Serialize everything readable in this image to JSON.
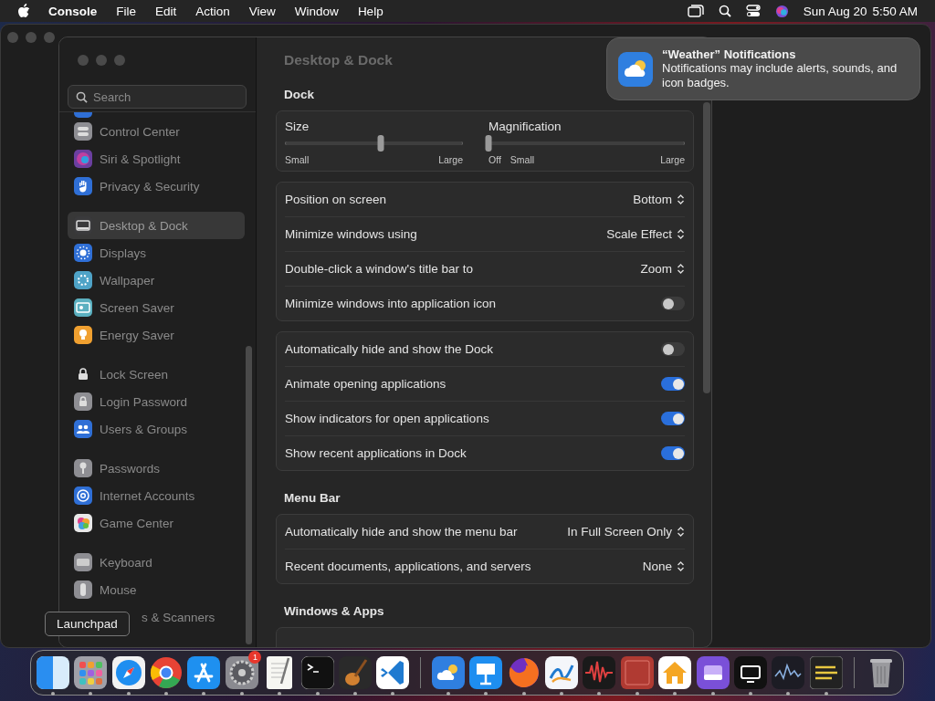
{
  "menu_bar": {
    "app": "Console",
    "menus": [
      "File",
      "Edit",
      "Action",
      "View",
      "Window"
    ],
    "help": "Help",
    "date": "Sun Aug 20",
    "time": "5:50 AM"
  },
  "sidebar": {
    "search": {
      "placeholder": "Search"
    },
    "groups": [
      [
        {
          "label": "Control Center",
          "selected": false
        },
        {
          "label": "Siri & Spotlight",
          "selected": false
        },
        {
          "label": "Privacy & Security",
          "selected": false
        }
      ],
      [
        {
          "label": "Desktop & Dock",
          "selected": true
        },
        {
          "label": "Displays",
          "selected": false
        },
        {
          "label": "Wallpaper",
          "selected": false
        },
        {
          "label": "Screen Saver",
          "selected": false
        },
        {
          "label": "Energy Saver",
          "selected": false
        }
      ],
      [
        {
          "label": "Lock Screen",
          "selected": false
        },
        {
          "label": "Login Password",
          "selected": false
        },
        {
          "label": "Users & Groups",
          "selected": false
        }
      ],
      [
        {
          "label": "Passwords",
          "selected": false
        },
        {
          "label": "Internet Accounts",
          "selected": false
        },
        {
          "label": "Game Center",
          "selected": false
        }
      ],
      [
        {
          "label": "Keyboard",
          "selected": false
        },
        {
          "label": "Mouse",
          "selected": false
        },
        {
          "label": "s & Scanners",
          "selected": false,
          "kind": "covered"
        }
      ]
    ]
  },
  "content": {
    "title": "Desktop & Dock",
    "sections": [
      {
        "heading": "Dock",
        "cards": [
          {
            "kind": "sliders",
            "sliders": [
              {
                "label": "Size",
                "level": 0.54,
                "min_label": "Small",
                "max_label": "Large"
              },
              {
                "label": "Magnification",
                "level": 0,
                "off_label": "Off",
                "min_label": "Small",
                "max_label": "Large"
              }
            ]
          },
          {
            "kind": "rows",
            "rows": [
              {
                "kind": "popup",
                "label": "Position on screen",
                "value": "Bottom"
              },
              {
                "kind": "popup",
                "label": "Minimize windows using",
                "value": "Scale Effect"
              },
              {
                "kind": "popup",
                "label": "Double-click a window's title bar to",
                "value": "Zoom"
              },
              {
                "kind": "toggle",
                "label": "Minimize windows into application icon",
                "on": false
              }
            ]
          },
          {
            "kind": "rows",
            "rows": [
              {
                "kind": "toggle",
                "label": "Automatically hide and show the Dock",
                "on": false
              },
              {
                "kind": "toggle",
                "label": "Animate opening applications",
                "on": true
              },
              {
                "kind": "toggle",
                "label": "Show indicators for open applications",
                "on": true
              },
              {
                "kind": "toggle",
                "label": "Show recent applications in Dock",
                "on": true
              }
            ]
          }
        ]
      },
      {
        "heading": "Menu Bar",
        "cards": [
          {
            "kind": "rows",
            "rows": [
              {
                "kind": "popup",
                "label": "Automatically hide and show the menu bar",
                "value": "In Full Screen Only"
              },
              {
                "kind": "popup",
                "label": "Recent documents, applications, and servers",
                "value": "None"
              }
            ]
          }
        ]
      },
      {
        "heading": "Windows & Apps",
        "cards": [
          {
            "kind": "clipped"
          }
        ]
      }
    ]
  },
  "notification": {
    "title": "“Weather” Notifications",
    "body": "Notifications may include alerts, sounds, and icon badges."
  },
  "tooltip": "Launchpad",
  "dock": {
    "items": [
      {
        "running": true
      },
      {
        "running": true
      },
      {
        "running": true
      },
      {
        "running": true
      },
      {
        "running": true
      },
      {
        "running": true,
        "badge": "1"
      },
      {
        "running": true
      },
      {
        "running": true
      },
      {
        "running": true
      },
      {
        "running": true
      },
      {
        "running": true,
        "separator_before": true
      },
      {
        "running": true
      },
      {
        "running": true
      },
      {
        "running": true
      },
      {
        "running": true
      },
      {
        "running": true
      },
      {
        "running": true
      },
      {
        "running": true
      },
      {
        "running": true
      },
      {
        "running": true
      },
      {
        "running": true
      },
      {
        "separator_before": true
      }
    ]
  }
}
